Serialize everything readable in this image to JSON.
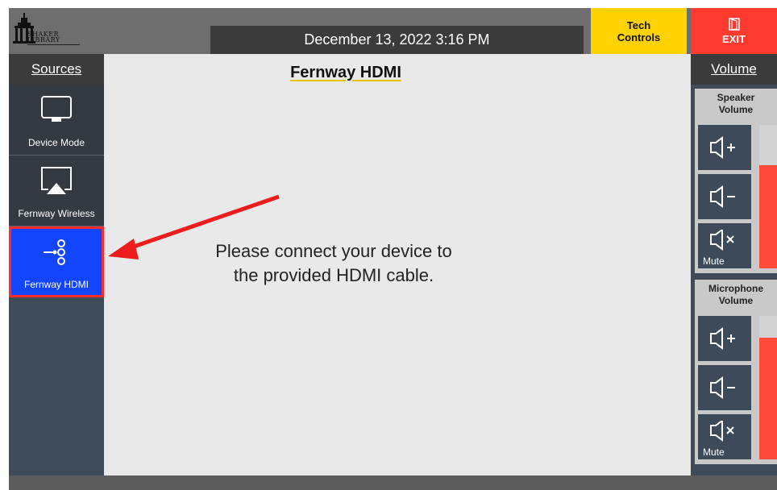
{
  "header": {
    "logo_text": "SHAKER\nLIBRARY",
    "datetime": "December 13, 2022 3:16 PM",
    "tech_controls_label": "Tech Controls",
    "exit_label": "EXIT",
    "exit_icon": "door-icon"
  },
  "sources": {
    "title": "Sources",
    "items": [
      {
        "label": "Device Mode",
        "icon": "monitor-icon",
        "active": false
      },
      {
        "label": "Fernway Wireless",
        "icon": "airplay-icon",
        "active": false
      },
      {
        "label": "Fernway HDMI",
        "icon": "hdmi-icon",
        "active": true
      }
    ]
  },
  "main": {
    "source_title": "Fernway HDMI",
    "instruction_line1": "Please connect your device to",
    "instruction_line2": "the provided HDMI cable."
  },
  "volume": {
    "title": "Volume",
    "groups": [
      {
        "label_line1": "Speaker",
        "label_line2": "Volume",
        "level": 0.72,
        "mute_label": "Mute"
      },
      {
        "label_line1": "Microphone",
        "label_line2": "Volume",
        "level": 0.85,
        "mute_label": "Mute"
      }
    ]
  },
  "colors": {
    "active_source": "#1345ff",
    "highlight_outline": "#ff2a2a",
    "tech_button": "#ffd200",
    "exit_button": "#ff3b30",
    "meter_fill": "#ff4a3a"
  }
}
